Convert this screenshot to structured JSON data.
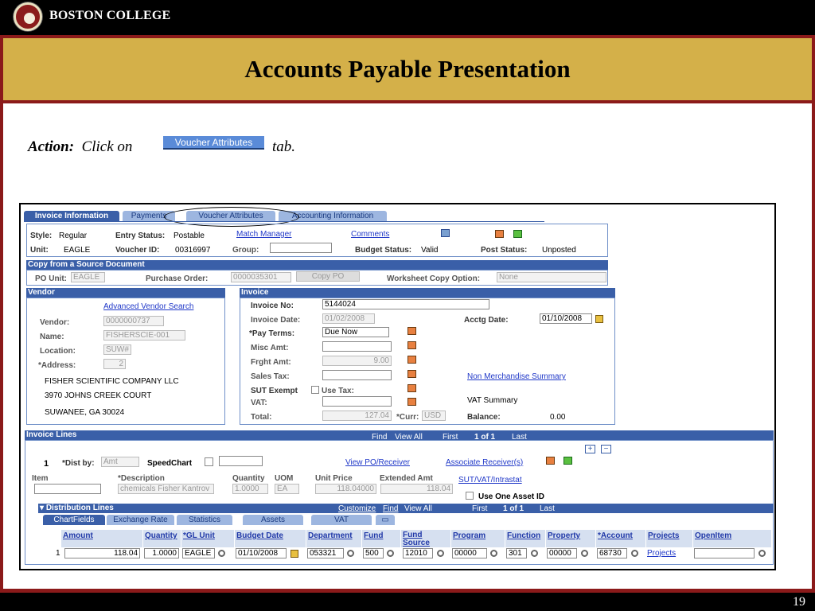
{
  "slide": {
    "org": "BOSTON COLLEGE",
    "title": "Accounts Payable Presentation",
    "page": "19"
  },
  "action": {
    "label": "Action:",
    "text": "Click on",
    "button": "Voucher Attributes",
    "suffix": "tab."
  },
  "tabs": [
    "Invoice Information",
    "Payments",
    "Voucher Attributes",
    "Accounting Information"
  ],
  "header": {
    "style_label": "Style:",
    "style": "Regular",
    "entry_status_label": "Entry Status:",
    "entry_status": "Postable",
    "match_manager": "Match Manager",
    "comments": "Comments",
    "unit_label": "Unit:",
    "unit": "EAGLE",
    "voucher_id_label": "Voucher ID:",
    "voucher_id": "00316997",
    "group_label": "Group:",
    "budget_status_label": "Budget Status:",
    "budget_status": "Valid",
    "post_status_label": "Post Status:",
    "post_status": "Unposted"
  },
  "copy": {
    "title": "Copy from a Source Document",
    "po_unit_label": "PO Unit:",
    "po_unit": "EAGLE",
    "po_label": "Purchase Order:",
    "po": "0000035301",
    "copy_po": "Copy PO",
    "worksheet_label": "Worksheet Copy Option:",
    "worksheet": "None"
  },
  "vendor": {
    "title": "Vendor",
    "advanced": "Advanced Vendor Search",
    "vendor_label": "Vendor:",
    "vendor": "0000000737",
    "name_label": "Name:",
    "name": "FISHERSCIE-001",
    "location_label": "Location:",
    "location": "SUW#",
    "address_label": "*Address:",
    "address": "2",
    "line1": "FISHER SCIENTIFIC COMPANY LLC",
    "line2": "3970 JOHNS CREEK COURT",
    "line3": "SUWANEE, GA  30024"
  },
  "invoice": {
    "title": "Invoice",
    "no_label": "Invoice No:",
    "no": "5144024",
    "date_label": "Invoice Date:",
    "date": "01/02/2008",
    "acctg_label": "Acctg Date:",
    "acctg": "01/10/2008",
    "pay_terms_label": "*Pay Terms:",
    "pay_terms": "Due Now",
    "misc_label": "Misc Amt:",
    "freight_label": "Frght Amt:",
    "freight": "9.00",
    "sales_tax_label": "Sales Tax:",
    "non_merch": "Non Merchandise Summary",
    "sut_label": "SUT Exempt",
    "use_tax_label": "Use Tax:",
    "vat_label": "VAT:",
    "vat_summary": "VAT Summary",
    "total_label": "Total:",
    "total": "127.04",
    "curr_label": "*Curr:",
    "curr": "USD",
    "balance_label": "Balance:",
    "balance": "0.00"
  },
  "lines": {
    "title": "Invoice Lines",
    "find": "Find",
    "view_all": "View All",
    "first": "First",
    "count": "1 of 1",
    "last": "Last",
    "line_no": "1",
    "dist_by_label": "*Dist by:",
    "dist_by": "Amt",
    "speedchart_label": "SpeedChart",
    "view_po": "View PO/Receiver",
    "assoc": "Associate Receiver(s)",
    "item_label": "Item",
    "desc_label": "*Description",
    "desc": "chemicals Fisher Kantrov",
    "qty_label": "Quantity",
    "qty": "1.0000",
    "uom_label": "UOM",
    "uom": "EA",
    "unit_price_label": "Unit Price",
    "unit_price": "118.04000",
    "ext_label": "Extended Amt",
    "ext": "118.04",
    "sut_link": "SUT/VAT/Intrastat",
    "one_asset": "Use One Asset ID"
  },
  "dist": {
    "title": "Distribution Lines",
    "customize": "Customize",
    "find": "Find",
    "view_all": "View All",
    "first": "First",
    "count": "1 of 1",
    "last": "Last",
    "tabs": [
      "ChartFields",
      "Exchange Rate",
      "Statistics",
      "Assets",
      "VAT"
    ],
    "headers": [
      "Amount",
      "Quantity",
      "*GL Unit",
      "Budget Date",
      "Department",
      "Fund",
      "Fund Source",
      "Program",
      "Function",
      "Property",
      "*Account",
      "Projects",
      "OpenItem"
    ],
    "row": [
      "1",
      "118.04",
      "1.0000",
      "EAGLE",
      "01/10/2008",
      "053321",
      "500",
      "12010",
      "00000",
      "301",
      "00000",
      "68730",
      "Projects"
    ]
  }
}
